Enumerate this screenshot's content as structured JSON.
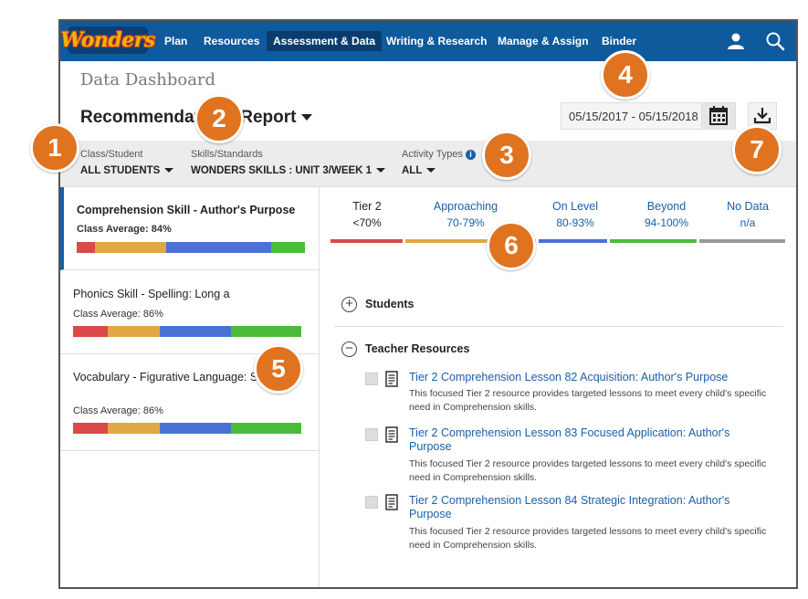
{
  "app": {
    "logo_text": "Wonders"
  },
  "nav": {
    "items": [
      {
        "label": "Plan"
      },
      {
        "label": "Resources"
      },
      {
        "label": "Assessment & Data",
        "active": true
      },
      {
        "label": "Writing & Research"
      },
      {
        "label": "Manage & Assign"
      },
      {
        "label": "Binder"
      }
    ],
    "icons": [
      "user-icon",
      "search-icon"
    ]
  },
  "header": {
    "page_title": "Data Dashboard",
    "report_title": "Recommendations Report",
    "date_range": "05/15/2017 - 05/15/2018"
  },
  "filters": {
    "class_student": {
      "label": "Class/Student",
      "value": "ALL STUDENTS"
    },
    "skills_standards": {
      "label": "Skills/Standards",
      "value": "WONDERS SKILLS : UNIT 3/WEEK 1"
    },
    "activity_types": {
      "label": "Activity Types",
      "value": "ALL"
    }
  },
  "skills": [
    {
      "name": "Comprehension Skill - Author's Purpose",
      "average": "Class Average: 84%",
      "selected": true,
      "distribution": [
        0.08,
        0.31,
        0.46,
        0.15
      ]
    },
    {
      "name": "Phonics Skill - Spelling: Long a",
      "average": "Class Average: 86%",
      "selected": false,
      "distribution": [
        0.15,
        0.23,
        0.31,
        0.31
      ]
    },
    {
      "name": "Vocabulary - Figurative Language: Similes",
      "average": "Class Average: 86%",
      "selected": false,
      "distribution": [
        0.15,
        0.23,
        0.31,
        0.31
      ]
    }
  ],
  "tiers": [
    {
      "name": "Tier 2",
      "range": "<70%",
      "color": "#d94a4a",
      "link": false
    },
    {
      "name": "Approaching",
      "range": "70-79%",
      "color": "#e0a844",
      "link": true
    },
    {
      "name": "On Level",
      "range": "80-93%",
      "color": "#4a72d4",
      "link": true
    },
    {
      "name": "Beyond",
      "range": "94-100%",
      "color": "#4cbb3c",
      "link": true
    },
    {
      "name": "No Data",
      "range": "n/a",
      "color": "#999999",
      "link": true
    }
  ],
  "sections": {
    "students": "Students",
    "teacher_resources": "Teacher Resources"
  },
  "resources": [
    {
      "title": "Tier 2 Comprehension Lesson 82 Acquisition: Author's Purpose",
      "description": "This focused Tier 2 resource provides targeted lessons to meet every child's specific need in Comprehension skills."
    },
    {
      "title": "Tier 2 Comprehension Lesson 83 Focused Application: Author's Purpose",
      "description": "This focused Tier 2 resource provides targeted lessons to meet every child's specific need in Comprehension skills."
    },
    {
      "title": "Tier 2 Comprehension Lesson 84 Strategic Integration: Author's Purpose",
      "description": "This focused Tier 2 resource provides targeted lessons to meet every child's specific need in Comprehension skills."
    }
  ],
  "callouts": [
    "1",
    "2",
    "3",
    "4",
    "5",
    "6",
    "7"
  ],
  "colors": {
    "nav_bg": "#0f5a9c",
    "link": "#1a5fa8",
    "callout": "#e0731f"
  }
}
